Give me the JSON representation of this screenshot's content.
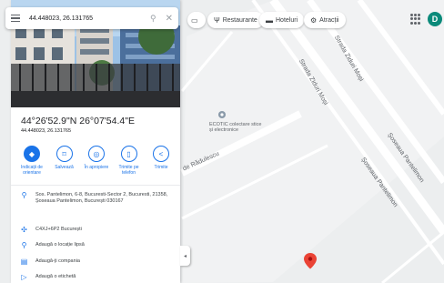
{
  "search": {
    "query": "44.448023, 26.131765"
  },
  "place": {
    "title": "44°26'52.9\"N 26°07'54.4\"E",
    "subtitle": "44.448023, 26.131765"
  },
  "actions": [
    {
      "label": "Indicații de orientare",
      "icon": "directions-icon",
      "glyph": "◆"
    },
    {
      "label": "Salvează",
      "icon": "bookmark-icon",
      "glyph": "⌑"
    },
    {
      "label": "În apropiere",
      "icon": "nearby-icon",
      "glyph": "◎"
    },
    {
      "label": "Trimite pe telefon",
      "icon": "phone-icon",
      "glyph": "▯"
    },
    {
      "label": "Trimite",
      "icon": "share-icon",
      "glyph": "<"
    }
  ],
  "info_rows": {
    "address": "Sos. Pantelimon, 6-8, Bucuresti-Sector 2, Bucuresti, 21358, Șoseaua Pantelimon, București 030167",
    "plus_code": "C4XJ+6P2 București",
    "add_place": "Adaugă o locație lipsă",
    "add_business": "Adaugă-ți compania",
    "add_label": "Adaugă o etichetă"
  },
  "map_chips": {
    "restaurants": "Restaurante",
    "hotels": "Hoteluri",
    "attractions": "Atracții"
  },
  "avatar_letter": "D",
  "map_labels": {
    "street1": "Strada Ziduri Moși",
    "street2": "Strada Ziduri Moși",
    "street3": "Șoseaua Pantelimon",
    "street4": "Șoseaua Pantelimon",
    "street5": "de Rădulescu",
    "poi": "ECOTIC colectare stice și electronice"
  },
  "colors": {
    "accent": "#1a73e8",
    "pin": "#ea4335",
    "avatar": "#0b8a7a"
  }
}
